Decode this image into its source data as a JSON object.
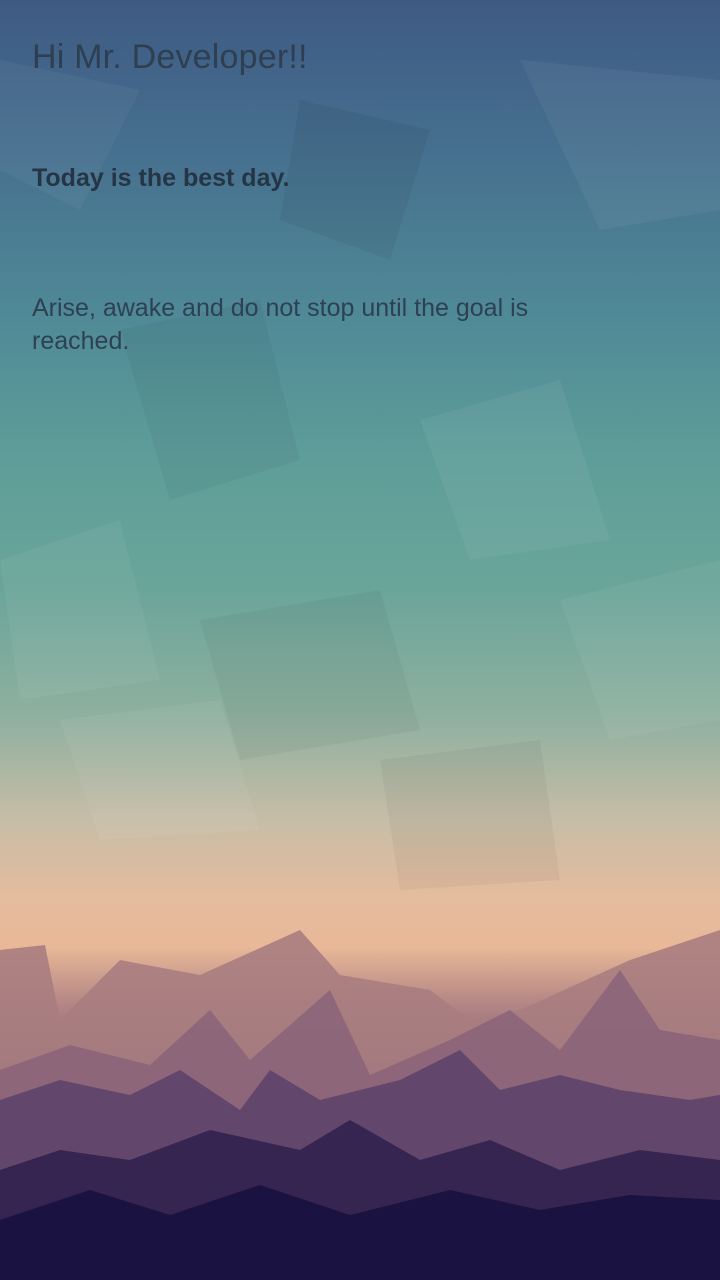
{
  "screen": {
    "greeting": "Hi Mr. Developer!!",
    "headline": "Today is the best day.",
    "quote": "Arise, awake and do not stop until the goal is reached."
  },
  "colors": {
    "sky_top": "#3e5a83",
    "teal_mid": "#5e9e99",
    "peach": "#e8b898",
    "mauve": "#7f5a77",
    "night": "#120c34",
    "text_dark": "#2f3f52"
  }
}
